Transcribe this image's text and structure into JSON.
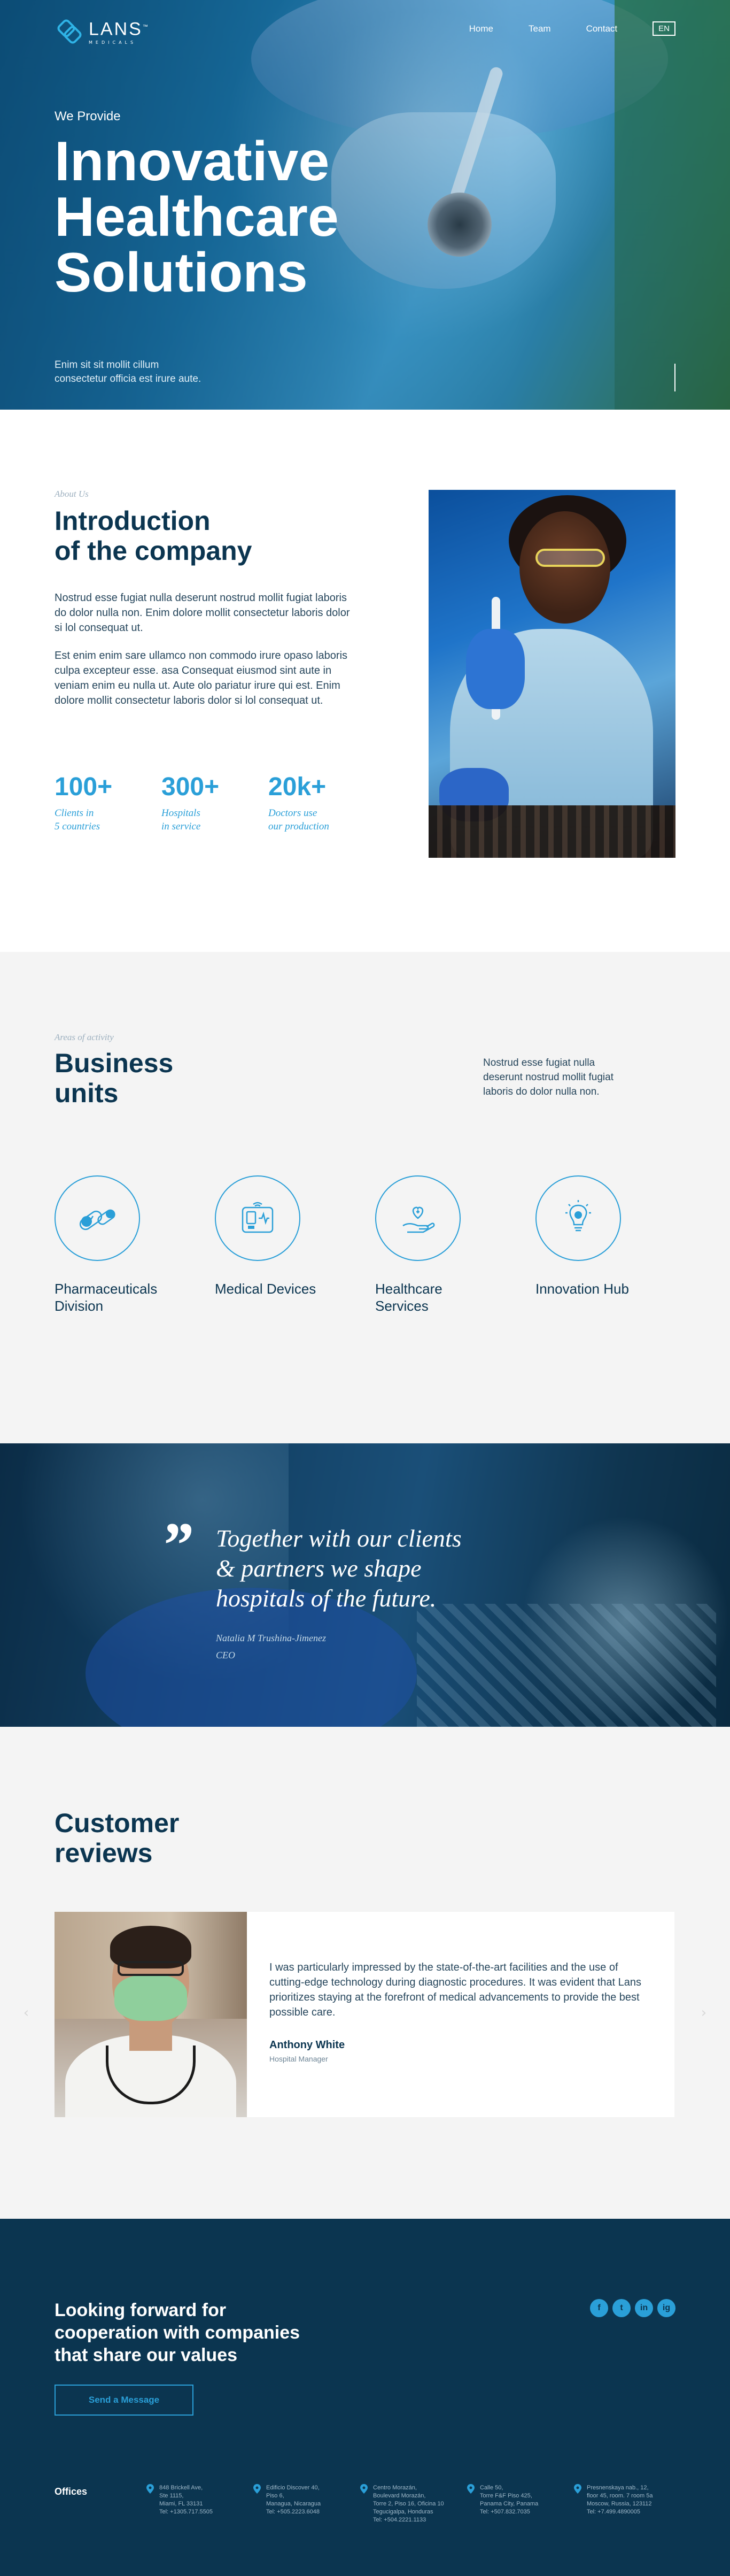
{
  "nav": {
    "logo_name": "LANS",
    "logo_tm": "™",
    "logo_sub": "MEDICALS",
    "links": [
      "Home",
      "Team",
      "Contact"
    ],
    "lang": "EN"
  },
  "hero": {
    "kicker": "We Provide",
    "title_lines": [
      "Innovative",
      "Healthcare",
      "Solutions"
    ],
    "desc_lines": [
      "Enim sit sit mollit cillum",
      "consectetur officia est irure aute."
    ]
  },
  "intro": {
    "kicker": "About Us",
    "title_lines": [
      "Introduction",
      "of the company"
    ],
    "p1": "Nostrud esse fugiat nulla deserunt nostrud mollit fugiat laboris do dolor nulla non. Enim dolore mollit consectetur laboris dolor  si lol consequat ut.",
    "p2": "Est enim enim sare  ullamco non commodo irure opaso laboris culpa excepteur esse. asa Consequat eiusmod sint aute in veniam enim eu nulla ut. Aute olo pariatur irure qui est.  Enim dolore mollit consectetur laboris dolor  si lol consequat ut.",
    "stats": [
      {
        "num": "100+",
        "label_lines": [
          "Clients in",
          "5 countries"
        ]
      },
      {
        "num": "300+",
        "label_lines": [
          "Hospitals",
          "in service"
        ]
      },
      {
        "num": "20k+",
        "label_lines": [
          "Doctors use",
          "our production"
        ]
      }
    ]
  },
  "business": {
    "kicker": "Areas of activity",
    "title_lines": [
      "Business",
      "units"
    ],
    "desc": "Nostrud esse fugiat nulla deserunt nostrud mollit fugiat laboris do dolor nulla non.",
    "units": [
      {
        "label_lines": [
          "Pharmaceuticals",
          "Division"
        ],
        "icon": "pills-icon"
      },
      {
        "label_lines": [
          "Medical Devices"
        ],
        "icon": "monitor-device-icon"
      },
      {
        "label_lines": [
          "Healthcare",
          "Services"
        ],
        "icon": "hand-heart-icon"
      },
      {
        "label_lines": [
          "Innovation Hub"
        ],
        "icon": "lightbulb-icon"
      }
    ]
  },
  "quote": {
    "mark": "”",
    "text_lines": [
      "Together with our clients",
      "& partners we shape",
      "hospitals of the future."
    ],
    "author": "Natalia M Trushina-Jimenez",
    "role": "CEO"
  },
  "reviews": {
    "title_lines": [
      "Customer",
      "reviews"
    ],
    "text": "I was particularly impressed by the state-of-the-art facilities and the use of cutting-edge technology during diagnostic procedures. It was evident that Lans prioritizes staying at the forefront of medical advancements to provide the best possible care.",
    "name": "Anthony White",
    "role": "Hospital Manager",
    "prev": "‹",
    "next": "›"
  },
  "footer": {
    "title_lines": [
      "Looking forward for",
      "cooperation with companies",
      "that share our values"
    ],
    "button": "Send a Message",
    "socials": [
      "f",
      "t",
      "in",
      "ig"
    ],
    "offices_label": "Offices",
    "offices": [
      [
        "848 Brickell Ave,",
        "Ste 1115,",
        "Miami, FL 33131",
        "Tel: +1305.717.5505"
      ],
      [
        "Edificio Discover 40,",
        "Piso 6,",
        "Managua, Nicaragua",
        "Tel: +505.2223.6048"
      ],
      [
        "Centro Morazán,",
        "Boulevard Morazán,",
        "Torre 2, Piso 16, Oficina 10",
        "Tegucigalpa, Honduras",
        "Tel: +504.2221.1133"
      ],
      [
        "Calle 50,",
        "Torre F&F Piso 425,",
        "Panama City, Panama",
        "Tel: +507.832.7035"
      ],
      [
        "Presnenskaya nab., 12,",
        "floor 45, room. 7 room 5a",
        "Moscow, Russia, 123112",
        "Tel: +7.499.4890005"
      ]
    ]
  }
}
